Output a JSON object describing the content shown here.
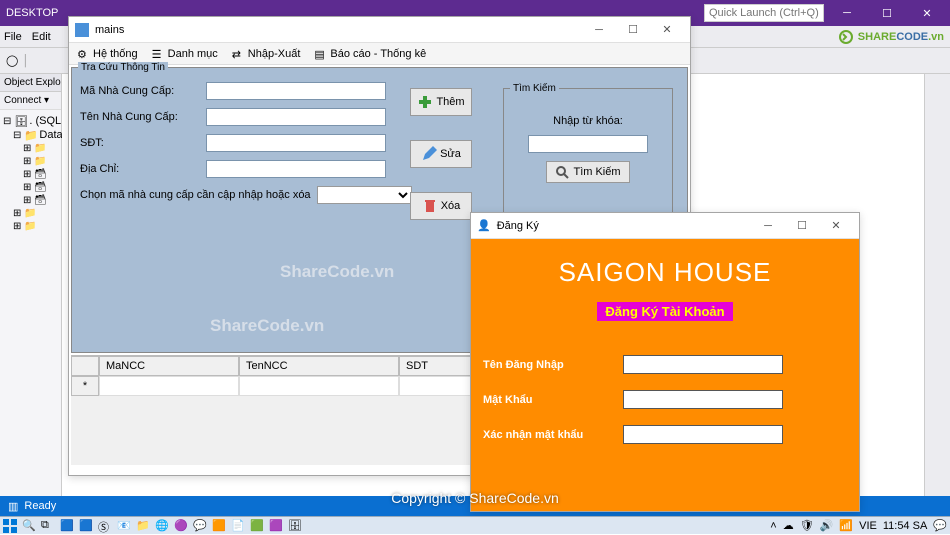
{
  "vs": {
    "title_prefix": "DESKTOP",
    "quick_launch_placeholder": "Quick Launch (Ctrl+Q)",
    "menu": [
      "File",
      "Edit"
    ],
    "status": "Ready"
  },
  "oe": {
    "title": "Object Explorer",
    "connect": "Connect ▾",
    "nodes": [
      ". (SQL S",
      "Data"
    ]
  },
  "mains": {
    "title": "mains",
    "menu": [
      {
        "label": "Hệ thống",
        "icon": "gear"
      },
      {
        "label": "Danh mục",
        "icon": "list"
      },
      {
        "label": "Nhập-Xuất",
        "icon": "swap"
      },
      {
        "label": "Báo cáo - Thống kê",
        "icon": "doc"
      }
    ],
    "lookup_legend": "Tra Cứu Thông Tin",
    "fields": {
      "code_label": "Mã Nhà Cung Cấp:",
      "name_label": "Tên Nhà Cung Cấp:",
      "phone_label": "SĐT:",
      "addr_label": "Địa Chỉ:",
      "choose_label": "Chọn mã nhà cung cấp cần cập nhập hoặc xóa"
    },
    "actions": {
      "add": "Thêm",
      "edit": "Sửa",
      "del": "Xóa"
    },
    "search": {
      "legend": "Tìm Kiếm",
      "label": "Nhập từ khóa:",
      "button": "Tìm Kiếm"
    },
    "grid": {
      "cols": [
        "MaNCC",
        "TenNCC",
        "SDT"
      ],
      "row_marker": "*"
    }
  },
  "reg": {
    "title": "Đăng Ký",
    "h1": "SAIGON HOUSE",
    "h2": "Đăng Ký Tài Khoản",
    "user_label": "Tên Đăng Nhập",
    "pass_label": "Mật Khẩu",
    "confirm_label": "Xác nhận mật khẩu"
  },
  "watermark": "ShareCode.vn",
  "copyright": "Copyright © ShareCode.vn",
  "logo": {
    "a": "SHARE",
    "b": "CODE",
    "c": ".vn"
  },
  "taskbar": {
    "lang": "VIE",
    "time": "11:54 SA"
  }
}
